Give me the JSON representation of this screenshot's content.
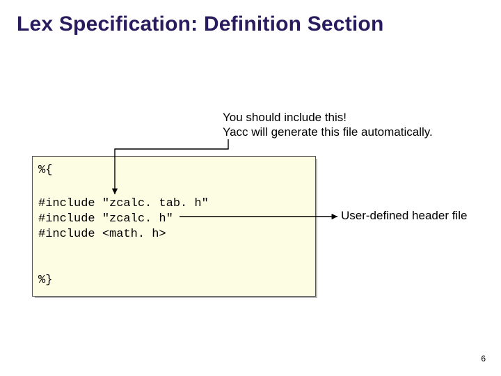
{
  "title": "Lex Specification: Definition Section",
  "annotations": {
    "top_line1": "You should include this!",
    "top_line2": "Yacc will generate this file automatically.",
    "right": "User-defined header file"
  },
  "code": {
    "l1": "%{",
    "l2": "#include \"zcalc. tab. h\"",
    "l3": "#include \"zcalc. h\"",
    "l4": "#include <math. h>",
    "l5": "%}"
  },
  "page_number": "6"
}
